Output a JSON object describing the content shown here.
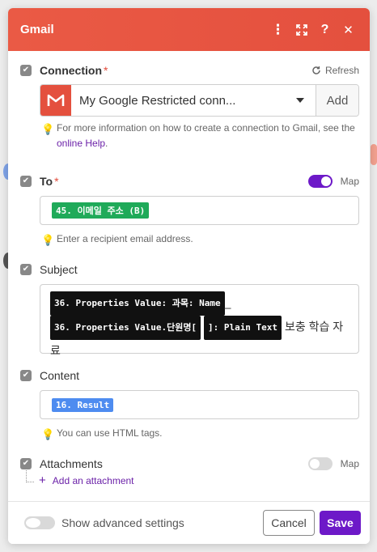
{
  "colors": {
    "header": "#e4503e",
    "accent_purple": "#6d19c8",
    "pill_green": "#1faa59",
    "pill_black": "#111111",
    "pill_blue": "#4e8cf0",
    "gmail_red": "#e4503e"
  },
  "header": {
    "title": "Gmail",
    "icons": [
      "kebab-menu-icon",
      "expand-icon",
      "help-icon",
      "close-icon"
    ],
    "help_label": "?",
    "close_label": "✕",
    "more_label": "⋮"
  },
  "connection": {
    "label": "Connection",
    "required_mark": "*",
    "refresh_label": "Refresh",
    "selected_value": "My Google Restricted conn...",
    "add_label": "Add",
    "hint_prefix": "For more information on how to create a connection to Gmail, see the ",
    "hint_link": "online Help",
    "hint_suffix": "."
  },
  "to": {
    "label": "To",
    "required_mark": "*",
    "map_label": "Map",
    "map_on": true,
    "pill": "45. 이메일 주소 (B)",
    "hint": "Enter a recipient email address."
  },
  "subject": {
    "label": "Subject",
    "pill_1": "36. Properties Value: 과목: Name",
    "sep_1": "_",
    "pill_2": "36. Properties Value.단원명[",
    "pill_3": "]: Plain Text",
    "tail_text": "보충 학습 자료"
  },
  "content": {
    "label": "Content",
    "pill": "16. Result",
    "hint": "You can use HTML tags."
  },
  "attachments": {
    "label": "Attachments",
    "map_label": "Map",
    "map_on": false,
    "add_label": "Add an attachment",
    "add_icon": "+"
  },
  "footer": {
    "advanced_label": "Show advanced settings",
    "advanced_on": false,
    "cancel_label": "Cancel",
    "save_label": "Save"
  }
}
